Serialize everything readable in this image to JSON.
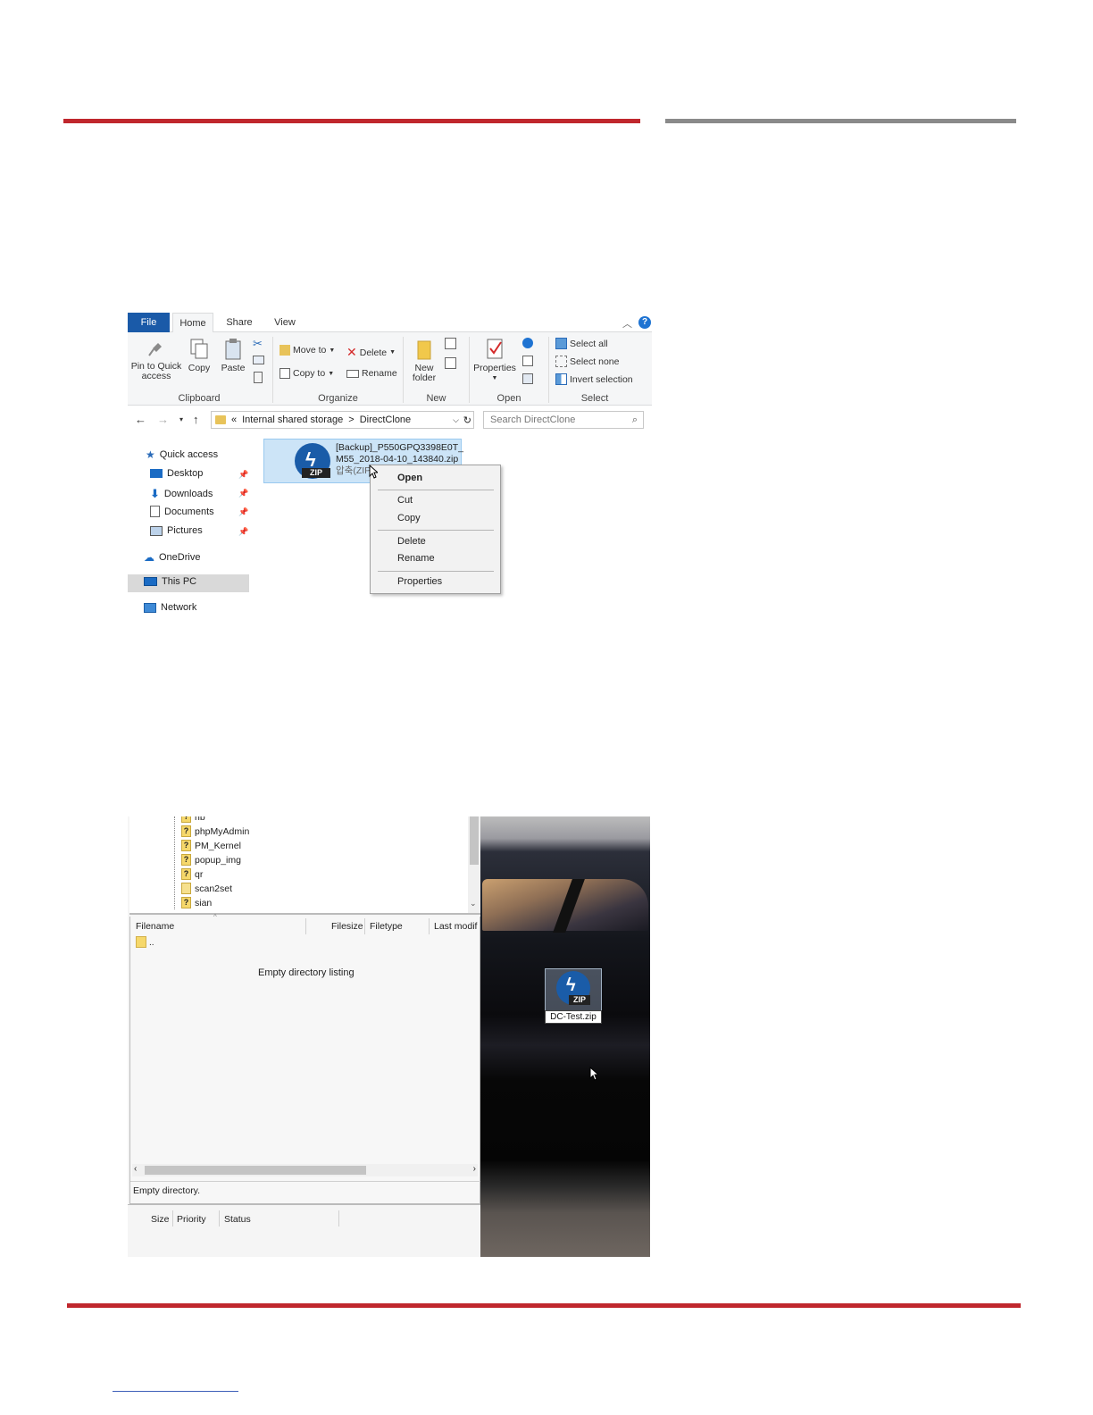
{
  "explorer": {
    "tabs": [
      "File",
      "Home",
      "Share",
      "View"
    ],
    "ribbon": {
      "clipboard": {
        "label": "Clipboard",
        "pin": "Pin to Quick access",
        "copy": "Copy",
        "paste": "Paste"
      },
      "organize": {
        "label": "Organize",
        "move_to": "Move to",
        "delete": "Delete",
        "copy_to": "Copy to",
        "rename": "Rename"
      },
      "new": {
        "label": "New",
        "new_folder": "New folder"
      },
      "open": {
        "label": "Open",
        "properties": "Properties"
      },
      "select": {
        "label": "Select",
        "select_all": "Select all",
        "select_none": "Select none",
        "invert": "Invert selection"
      }
    },
    "address": {
      "prefix": "«",
      "part1": "Internal shared storage",
      "sep": ">",
      "part2": "DirectClone"
    },
    "search_placeholder": "Search DirectClone",
    "nav": {
      "quick_access": "Quick access",
      "desktop": "Desktop",
      "downloads": "Downloads",
      "documents": "Documents",
      "pictures": "Pictures",
      "onedrive": "OneDrive",
      "this_pc": "This PC",
      "network": "Network"
    },
    "file": {
      "line1": "[Backup]_P550GPQ3398E0T_",
      "line2": "M55_2018-04-10_143840.zip",
      "line3": "압축(ZIP",
      "icon_tag": "ZIP"
    },
    "context_menu": [
      "Open",
      "Cut",
      "Copy",
      "Delete",
      "Rename",
      "Properties"
    ]
  },
  "ftp": {
    "tree": [
      "nb",
      "phpMyAdmin",
      "PM_Kernel",
      "popup_img",
      "qr",
      "scan2set",
      "sian"
    ],
    "columns": [
      "Filename",
      "Filesize",
      "Filetype",
      "Last modif"
    ],
    "parent_dir": "..",
    "empty_message": "Empty directory listing",
    "status": "Empty directory.",
    "queue_columns": [
      "Size",
      "Priority",
      "Status"
    ]
  },
  "desktop": {
    "zip_label": "DC-Test.zip",
    "icon_tag": "ZIP"
  },
  "colors": {
    "accent_red": "#c0272d",
    "accent_gray": "#8a8a8a",
    "file_tab": "#1a5aa8",
    "selection": "#cce4f7"
  }
}
